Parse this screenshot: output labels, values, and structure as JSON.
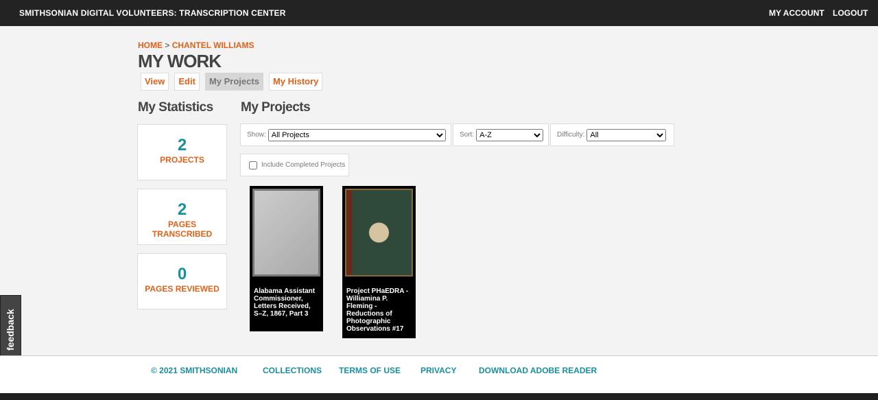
{
  "header": {
    "title": "SMITHSONIAN DIGITAL VOLUNTEERS: TRANSCRIPTION CENTER",
    "my_account": "MY ACCOUNT",
    "logout": "LOGOUT"
  },
  "breadcrumb": {
    "home": "HOME",
    "sep": ">",
    "user": "CHANTEL WILLIAMS"
  },
  "page_title": "MY WORK",
  "tabs": [
    {
      "label": "View"
    },
    {
      "label": "Edit"
    },
    {
      "label": "My Projects"
    },
    {
      "label": "My History"
    }
  ],
  "stats": {
    "heading": "My Statistics",
    "items": [
      {
        "value": "2",
        "label": "PROJECTS"
      },
      {
        "value": "2",
        "label": "PAGES TRANSCRIBED"
      },
      {
        "value": "0",
        "label": "PAGES REVIEWED"
      }
    ]
  },
  "projects": {
    "heading": "My Projects",
    "filters": {
      "show_label": "Show:",
      "show_value": "All Projects",
      "sort_label": "Sort:",
      "sort_value": "A-Z",
      "difficulty_label": "Difficulty:",
      "difficulty_value": "All"
    },
    "include_completed": "Include Completed Projects",
    "cards": [
      {
        "title": "Alabama Assistant Commissioner, Letters Received, S–Z, 1867, Part 3"
      },
      {
        "title": "Project PHaEDRA - Williamina P. Fleming - Reductions of Photographic Observations #17"
      }
    ]
  },
  "feedback": "feedback",
  "footer": {
    "copyright": "© 2021 SMITHSONIAN",
    "collections": "COLLECTIONS",
    "terms": "TERMS OF USE",
    "privacy": "PRIVACY",
    "adobe": "DOWNLOAD ADOBE READER"
  }
}
